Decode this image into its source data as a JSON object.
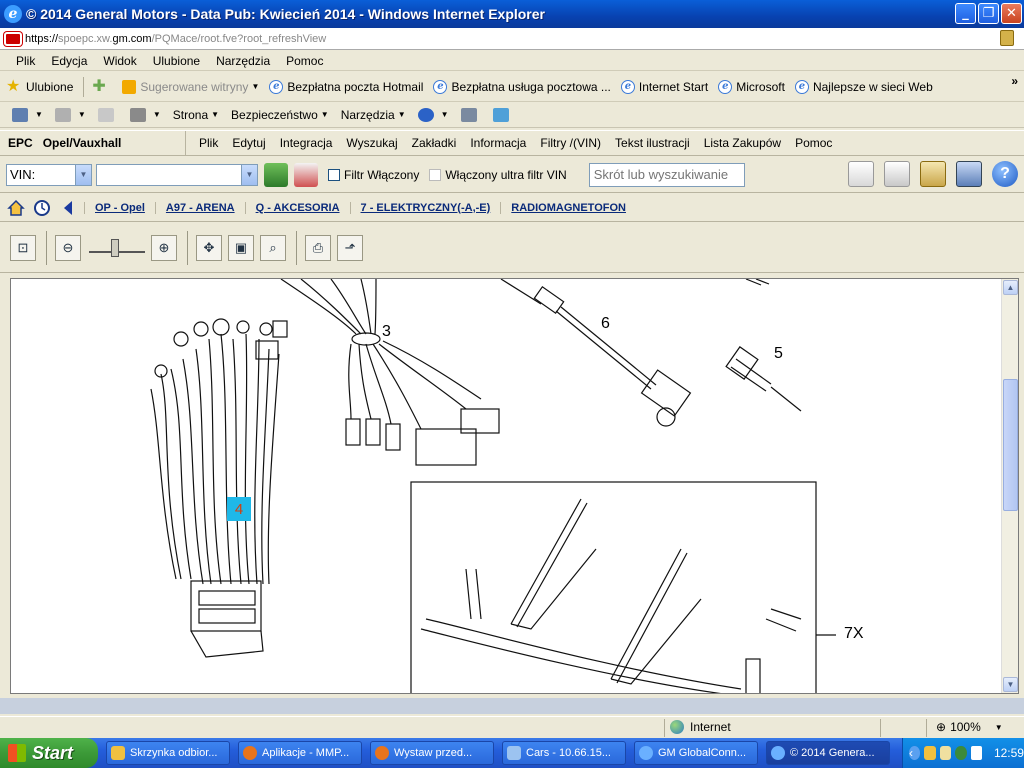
{
  "window": {
    "title": "© 2014 General Motors - Data Pub: Kwiecień 2014 - Windows Internet Explorer",
    "url_prefix": "https://",
    "url_mid": "spoepc.xw.",
    "url_domain": "gm.com",
    "url_path": "/PQMace/root.fve?root_refreshView",
    "buttons": {
      "minimize": "_",
      "maximize": "❐",
      "close": "✕"
    }
  },
  "menu": [
    "Plik",
    "Edycja",
    "Widok",
    "Ulubione",
    "Narzędzia",
    "Pomoc"
  ],
  "favorites": {
    "label": "Ulubione",
    "suggested": "Sugerowane witryny",
    "links": [
      "Bezpłatna poczta Hotmail",
      "Bezpłatna usługa pocztowa ...",
      "Internet Start",
      "Microsoft",
      "Najlepsze w sieci Web"
    ],
    "overflow": "»"
  },
  "command_bar": [
    "Strona",
    "Bezpieczeństwo",
    "Narzędzia"
  ],
  "epc": {
    "brand": "EPC",
    "region": "Opel/Vauxhall",
    "menu": [
      "Plik",
      "Edytuj",
      "Integracja",
      "Wyszukaj",
      "Zakładki",
      "Informacja",
      "Filtry /(VIN)",
      "Tekst ilustracji",
      "Lista Zakupów",
      "Pomoc"
    ]
  },
  "search": {
    "vin_label": "VIN:",
    "vin_value": "",
    "filter_on": "Filtr Włączony",
    "ultra_filter": "Włączony ultra filtr VIN",
    "quick_placeholder": "Skrót lub wyszukiwanie",
    "help": "?"
  },
  "breadcrumb": [
    "OP - Opel",
    "A97 - ARENA",
    "Q - AKCESORIA",
    "7 - ELEKTRYCZNY(-A,-E)",
    "RADIOMAGNETOFON"
  ],
  "diagram": {
    "labels": [
      "3",
      "6",
      "5",
      "7X"
    ],
    "callout": "4"
  },
  "statusbar": {
    "zone": "Internet",
    "zoom": "100%"
  },
  "taskbar": {
    "start": "Start",
    "tasks": [
      "Skrzynka odbior...",
      "Aplikacje - MMP...",
      "Wystaw przed...",
      "Cars - 10.66.15...",
      "GM GlobalConn...",
      "© 2014 Genera..."
    ],
    "clock": "12:59"
  },
  "colors": {
    "titlebar": "#0a50c8",
    "link": "#0a2a7a",
    "callout_bg": "#1eb8e8",
    "callout_text": "#d04010"
  }
}
